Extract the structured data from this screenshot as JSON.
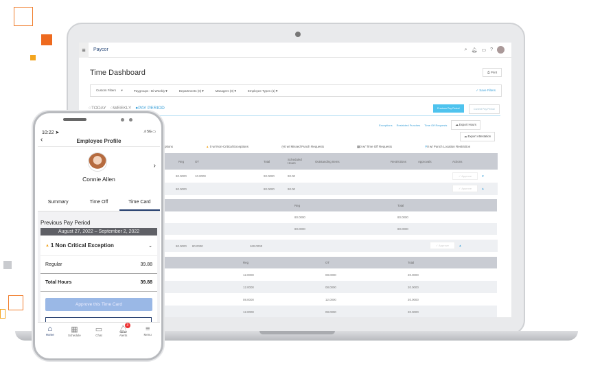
{
  "app": {
    "logo": "Paycor"
  },
  "dashboard": {
    "title": "Time Dashboard",
    "print": "Print",
    "filters": [
      "Custom Filters",
      "Paygroups : Bi-Weekly",
      "Departments (0)",
      "Managers (0)",
      "Employee Types (1)"
    ],
    "save_filters": "Save Filters",
    "range": [
      "TODAY",
      "WEEKLY",
      "PAY PERIOD"
    ],
    "previous_pay_period": "Previous Pay Period",
    "current_pay_period": "Current Pay Period",
    "links": [
      "Exceptions",
      "Restricted Punches",
      "Time Off Requests"
    ],
    "export_hours": "Export Hours",
    "export_attestation": "Export Attestation",
    "summary": [
      "Exceptions",
      "0 w/ Non-Critical Exceptions",
      "0 w/ Missed Punch Requests",
      "0 w/ Time Off Requests",
      "0 w/ Punch Location Restriction"
    ],
    "columns": [
      "Reg",
      "OT",
      "Total",
      "Scheduled Hours",
      "Outstanding Items",
      "Restrictions",
      "Approvals",
      "Actions"
    ],
    "approve": "Approve",
    "rows": [
      {
        "reg": "80.0000",
        "ot": "10.0000",
        "total": "90.0000",
        "sched": "90.00"
      },
      {
        "reg": "80.0000",
        "ot": "",
        "total": "80.0000",
        "sched": "90.00"
      }
    ],
    "sub1": {
      "columns": [
        "Reg",
        "Total"
      ],
      "rows": [
        [
          "80.0000",
          "80.0000"
        ],
        [
          "80.0000",
          "80.0000"
        ]
      ]
    },
    "row3": {
      "reg": "80.0000",
      "ot": "80.0000",
      "total": "160.0000"
    },
    "sub2": {
      "columns": [
        "Reg",
        "OT",
        "Total"
      ],
      "rows": [
        [
          "12.0000",
          "08.0000",
          "20.0000"
        ],
        [
          "12.0000",
          "08.0000",
          "20.0000"
        ],
        [
          "08.0000",
          "12.0000",
          "20.0000"
        ],
        [
          "12.0000",
          "08.0000",
          "20.0000"
        ]
      ]
    }
  },
  "phone": {
    "time": "10:22",
    "signal": "5G",
    "title": "Employee Profile",
    "name": "Connie Allen",
    "tabs": [
      "Summary",
      "Time Off",
      "Time Card"
    ],
    "period_label": "Previous Pay Period",
    "period_range": "August 27, 2022 – September 2, 2022",
    "exception": "1 Non Critical Exception",
    "regular_label": "Regular",
    "regular_value": "39.88",
    "total_label": "Total Hours",
    "total_value": "39.88",
    "approve": "Approve this Time Card",
    "nav": [
      "Home",
      "Schedule",
      "Chat",
      "Alerts",
      "Menu"
    ],
    "alerts_badge": "3"
  }
}
